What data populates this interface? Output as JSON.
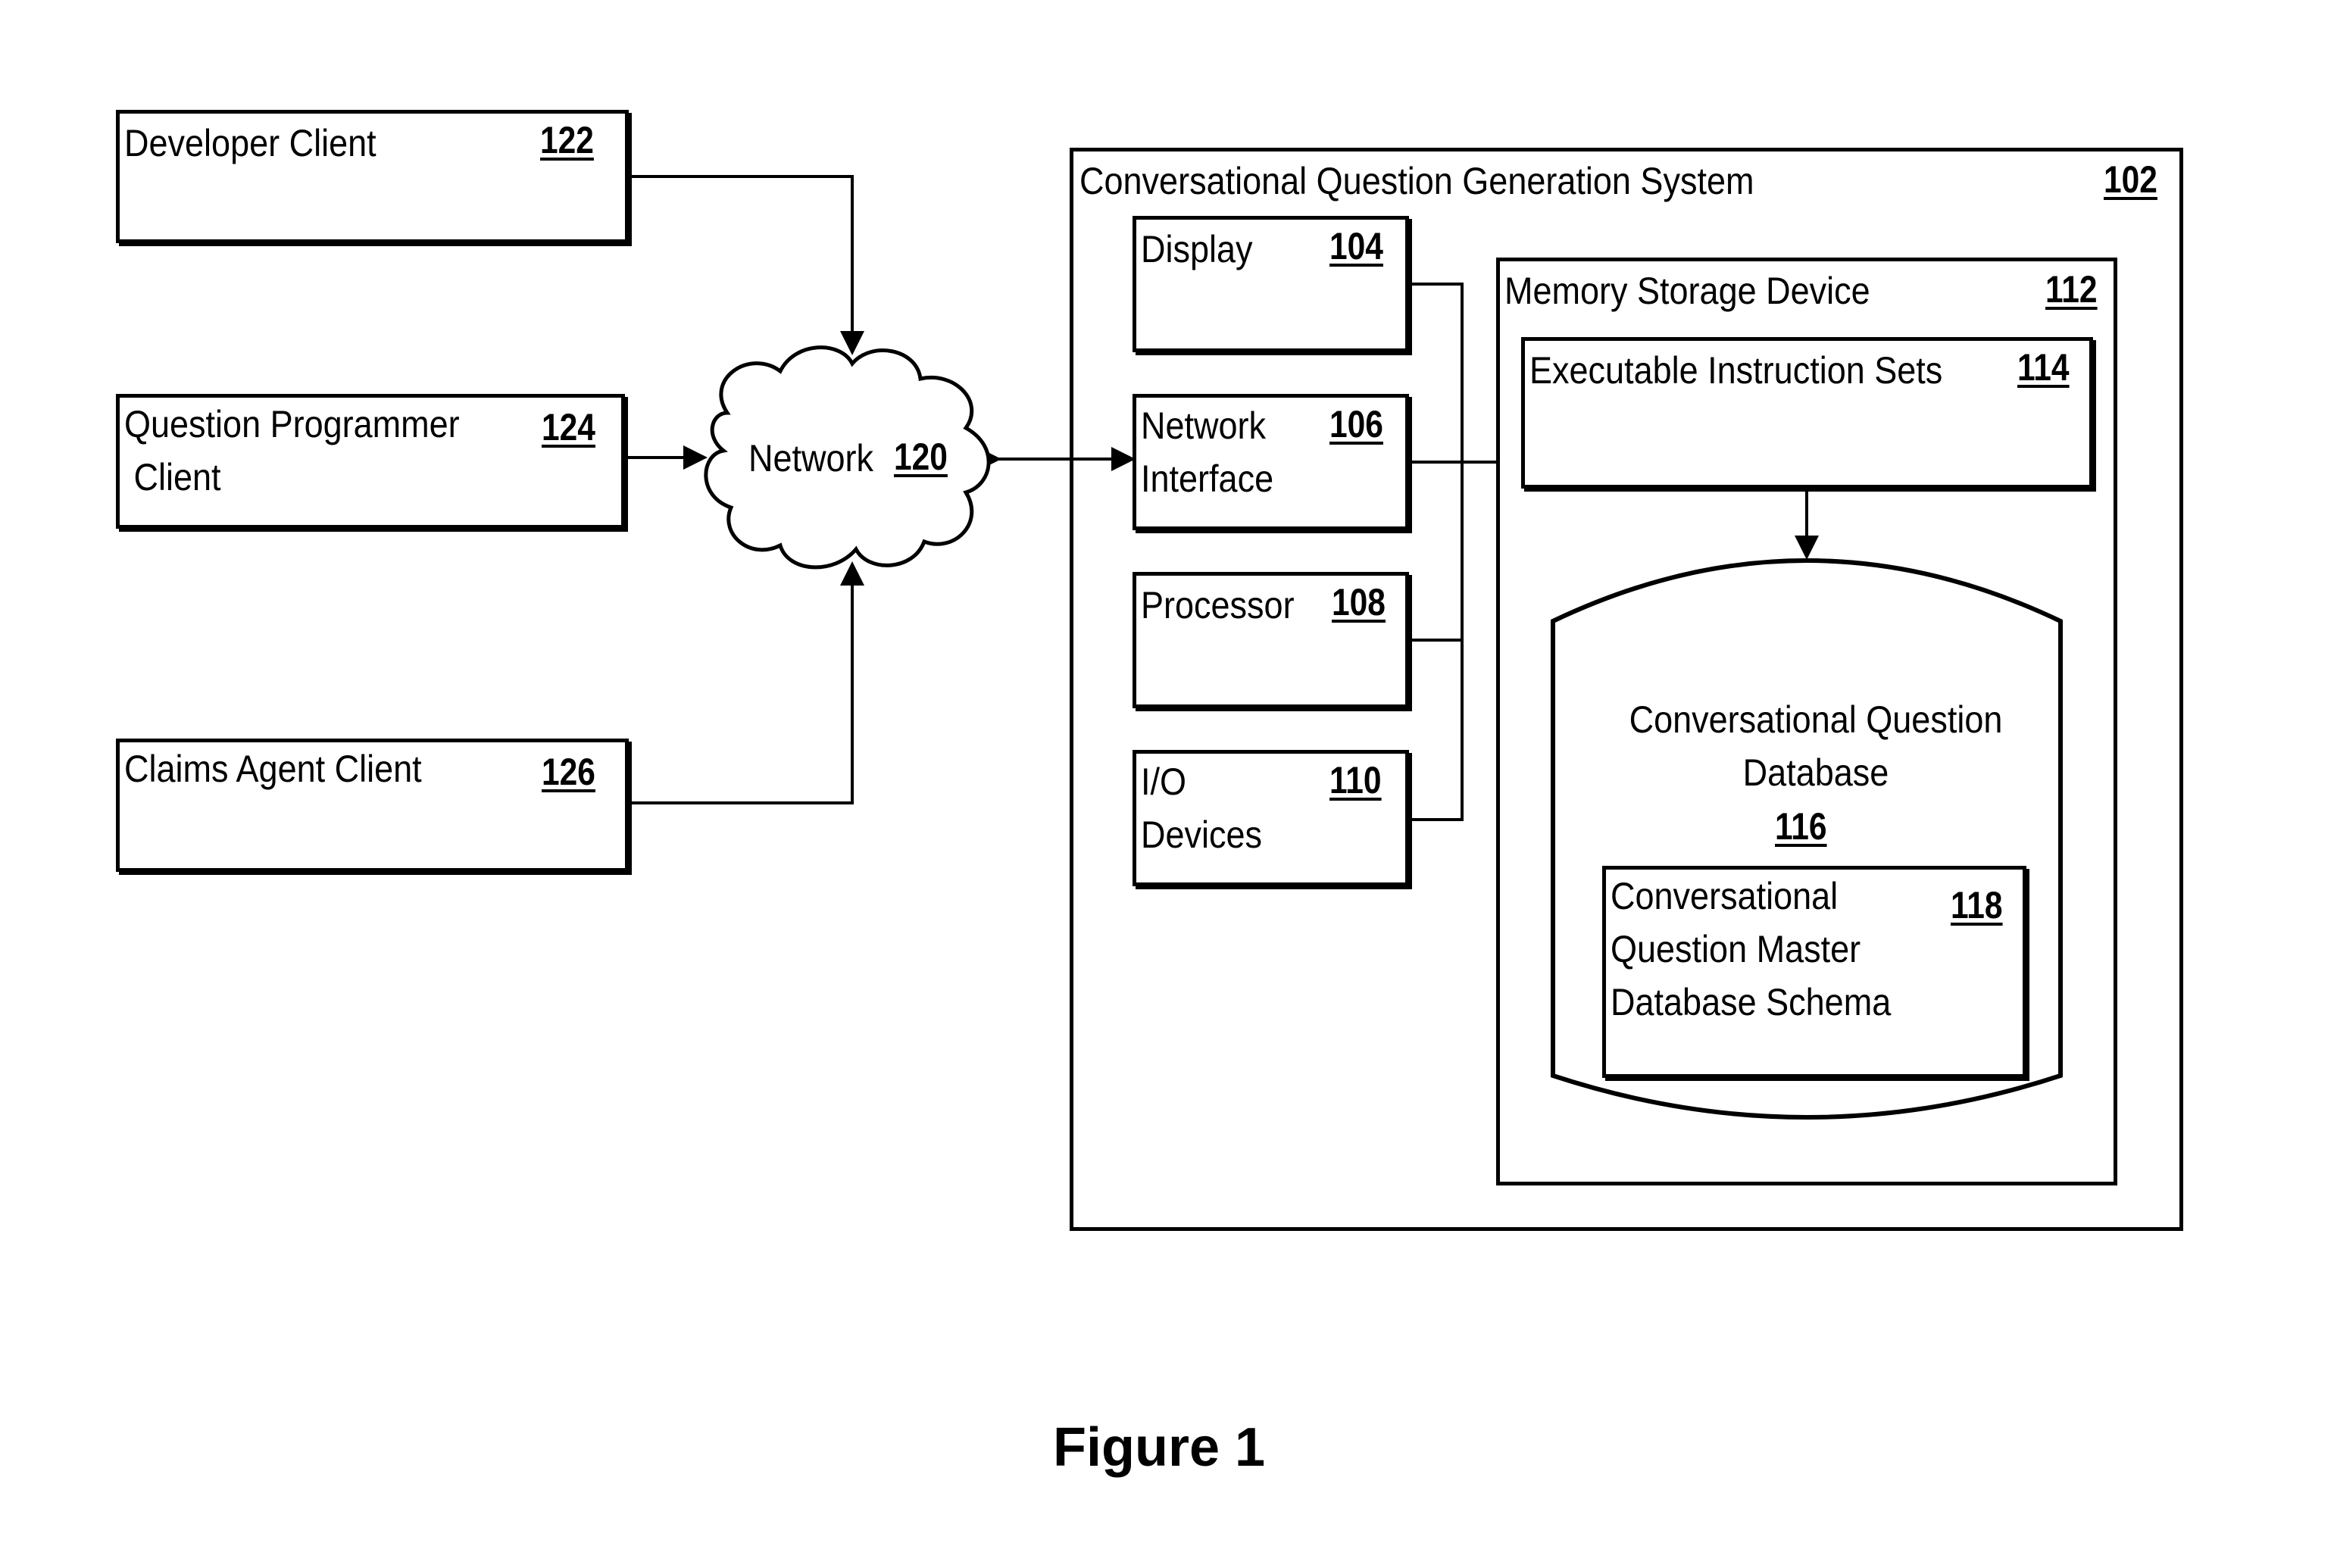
{
  "clients": [
    {
      "label": "Developer Client",
      "ref": "122"
    },
    {
      "label": "Question Programmer\n Client",
      "ref": "124"
    },
    {
      "label": "Claims Agent Client",
      "ref": "126"
    }
  ],
  "network": {
    "label": "Network",
    "ref": "120"
  },
  "system": {
    "label": "Conversational Question Generation System",
    "ref": "102"
  },
  "components": [
    {
      "label": "Display",
      "ref": "104"
    },
    {
      "label": "Network\nInterface",
      "ref": "106"
    },
    {
      "label": "Processor",
      "ref": "108"
    },
    {
      "label": "I/O\nDevices",
      "ref": "110"
    }
  ],
  "memory": {
    "label": "Memory Storage Device",
    "ref": "112"
  },
  "instructions": {
    "label": "Executable Instruction Sets",
    "ref": "114"
  },
  "database": {
    "label": "Conversational Question\nDatabase",
    "ref": "116"
  },
  "schema": {
    "label": "Conversational\nQuestion Master\nDatabase Schema",
    "ref": "118"
  },
  "caption": "Figure 1"
}
